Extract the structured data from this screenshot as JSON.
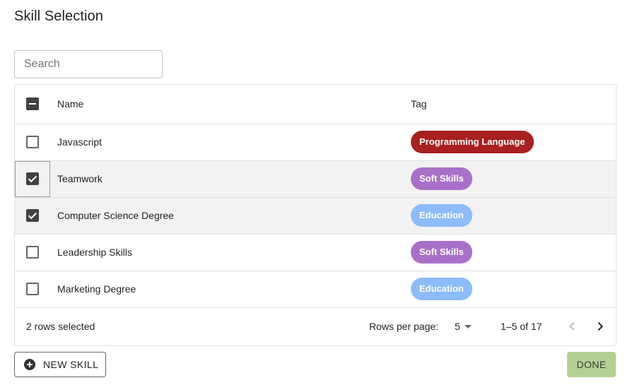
{
  "page": {
    "title": "Skill Selection"
  },
  "search": {
    "placeholder": "Search",
    "value": ""
  },
  "table": {
    "columns": {
      "name": "Name",
      "tag": "Tag"
    },
    "header_checkbox_state": "indeterminate",
    "rows": [
      {
        "name": "Javascript",
        "tag": "Programming Language",
        "tag_color": "#a8201f",
        "checked": false
      },
      {
        "name": "Teamwork",
        "tag": "Soft Skills",
        "tag_color": "#a970c9",
        "checked": true
      },
      {
        "name": "Computer Science Degree",
        "tag": "Education",
        "tag_color": "#8cbcfa",
        "checked": true
      },
      {
        "name": "Leadership Skills",
        "tag": "Soft Skills",
        "tag_color": "#a970c9",
        "checked": false
      },
      {
        "name": "Marketing Degree",
        "tag": "Education",
        "tag_color": "#8cbcfa",
        "checked": false
      }
    ]
  },
  "footer": {
    "selected_text": "2 rows selected",
    "rows_per_page_label": "Rows per page:",
    "rows_per_page_value": "5",
    "range_text": "1–5 of 17",
    "prev_icon": "chevron-left-icon",
    "next_icon": "chevron-right-icon"
  },
  "actions": {
    "new_skill_label": "NEW SKILL",
    "new_skill_icon": "add-circle-icon",
    "done_label": "DONE",
    "done_color": "#b5cf95"
  }
}
